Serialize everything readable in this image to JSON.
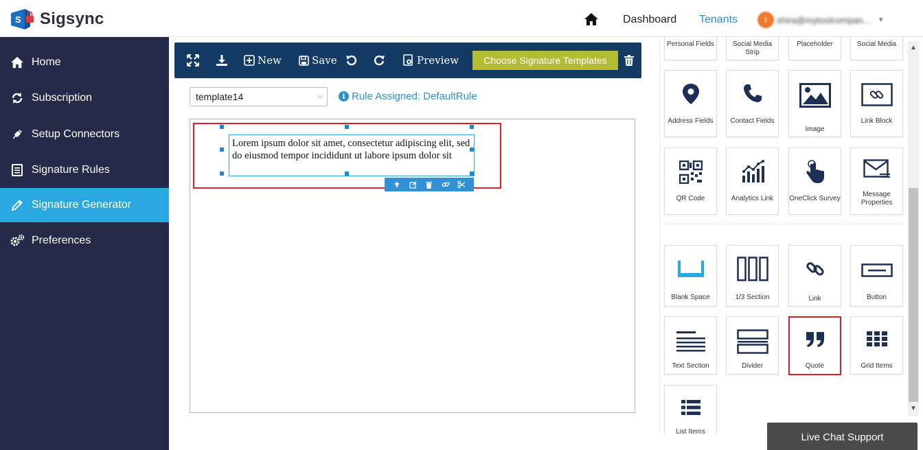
{
  "app": {
    "name": "Sigsync"
  },
  "header": {
    "dashboard": "Dashboard",
    "tenants": "Tenants",
    "avatar_initial": "I",
    "user_email": "shira@mytoolcompan..."
  },
  "sidebar": {
    "items": [
      {
        "label": "Home",
        "icon": "home-icon"
      },
      {
        "label": "Subscription",
        "icon": "sync-icon"
      },
      {
        "label": "Setup Connectors",
        "icon": "plug-icon"
      },
      {
        "label": "Signature Rules",
        "icon": "document-icon"
      },
      {
        "label": "Signature Generator",
        "icon": "pencil-icon"
      },
      {
        "label": "Preferences",
        "icon": "gears-icon"
      }
    ],
    "active_index": 4
  },
  "toolbar": {
    "new_label": "New",
    "save_label": "Save",
    "preview_label": "Preview",
    "choose_label": "Choose Signature Templates"
  },
  "editor": {
    "template_value": "template14",
    "rule_label": "Rule Assigned: DefaultRule",
    "text_content": "Lorem ipsum dolor sit amet, consectetur adipiscing elit, sed do eiusmod tempor incididunt ut labore ipsum dolor sit"
  },
  "palette": {
    "row0": [
      "Personal Fields",
      "Social Media Strip",
      "Placeholder",
      "Social Media"
    ],
    "row1": [
      "Address Fields",
      "Contact Fields",
      "Image",
      "Link Block"
    ],
    "row2": [
      "QR Code",
      "Analytics Link",
      "OneClick Survey",
      "Message Properties"
    ],
    "row3": [
      "Blank Space",
      "1/3 Section",
      "Link",
      "Button"
    ],
    "row4": [
      "Text Section",
      "Divider",
      "Quote",
      "Grid Items"
    ],
    "row5": [
      "List Items"
    ]
  },
  "chat": {
    "label": "Live Chat Support"
  },
  "colors": {
    "sidebar_bg": "#252a48",
    "sidebar_active": "#29a9e0",
    "toolbar_bg": "#123a63",
    "choose_btn": "#b3bc32",
    "accent_blue": "#2a8fcf",
    "highlight_red": "#e02020",
    "icon_navy": "#1d2f52"
  }
}
